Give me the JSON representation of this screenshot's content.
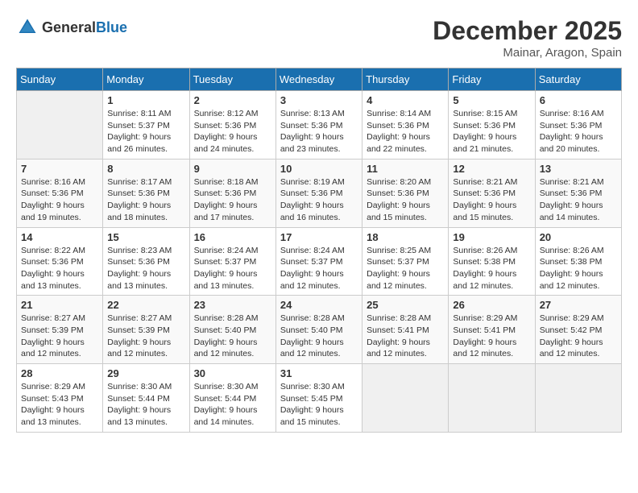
{
  "header": {
    "logo_general": "General",
    "logo_blue": "Blue",
    "title": "December 2025",
    "location": "Mainar, Aragon, Spain"
  },
  "weekdays": [
    "Sunday",
    "Monday",
    "Tuesday",
    "Wednesday",
    "Thursday",
    "Friday",
    "Saturday"
  ],
  "weeks": [
    [
      {
        "day": "",
        "info": ""
      },
      {
        "day": "1",
        "info": "Sunrise: 8:11 AM\nSunset: 5:37 PM\nDaylight: 9 hours and 26 minutes."
      },
      {
        "day": "2",
        "info": "Sunrise: 8:12 AM\nSunset: 5:36 PM\nDaylight: 9 hours and 24 minutes."
      },
      {
        "day": "3",
        "info": "Sunrise: 8:13 AM\nSunset: 5:36 PM\nDaylight: 9 hours and 23 minutes."
      },
      {
        "day": "4",
        "info": "Sunrise: 8:14 AM\nSunset: 5:36 PM\nDaylight: 9 hours and 22 minutes."
      },
      {
        "day": "5",
        "info": "Sunrise: 8:15 AM\nSunset: 5:36 PM\nDaylight: 9 hours and 21 minutes."
      },
      {
        "day": "6",
        "info": "Sunrise: 8:16 AM\nSunset: 5:36 PM\nDaylight: 9 hours and 20 minutes."
      }
    ],
    [
      {
        "day": "7",
        "info": "Sunrise: 8:16 AM\nSunset: 5:36 PM\nDaylight: 9 hours and 19 minutes."
      },
      {
        "day": "8",
        "info": "Sunrise: 8:17 AM\nSunset: 5:36 PM\nDaylight: 9 hours and 18 minutes."
      },
      {
        "day": "9",
        "info": "Sunrise: 8:18 AM\nSunset: 5:36 PM\nDaylight: 9 hours and 17 minutes."
      },
      {
        "day": "10",
        "info": "Sunrise: 8:19 AM\nSunset: 5:36 PM\nDaylight: 9 hours and 16 minutes."
      },
      {
        "day": "11",
        "info": "Sunrise: 8:20 AM\nSunset: 5:36 PM\nDaylight: 9 hours and 15 minutes."
      },
      {
        "day": "12",
        "info": "Sunrise: 8:21 AM\nSunset: 5:36 PM\nDaylight: 9 hours and 15 minutes."
      },
      {
        "day": "13",
        "info": "Sunrise: 8:21 AM\nSunset: 5:36 PM\nDaylight: 9 hours and 14 minutes."
      }
    ],
    [
      {
        "day": "14",
        "info": "Sunrise: 8:22 AM\nSunset: 5:36 PM\nDaylight: 9 hours and 13 minutes."
      },
      {
        "day": "15",
        "info": "Sunrise: 8:23 AM\nSunset: 5:36 PM\nDaylight: 9 hours and 13 minutes."
      },
      {
        "day": "16",
        "info": "Sunrise: 8:24 AM\nSunset: 5:37 PM\nDaylight: 9 hours and 13 minutes."
      },
      {
        "day": "17",
        "info": "Sunrise: 8:24 AM\nSunset: 5:37 PM\nDaylight: 9 hours and 12 minutes."
      },
      {
        "day": "18",
        "info": "Sunrise: 8:25 AM\nSunset: 5:37 PM\nDaylight: 9 hours and 12 minutes."
      },
      {
        "day": "19",
        "info": "Sunrise: 8:26 AM\nSunset: 5:38 PM\nDaylight: 9 hours and 12 minutes."
      },
      {
        "day": "20",
        "info": "Sunrise: 8:26 AM\nSunset: 5:38 PM\nDaylight: 9 hours and 12 minutes."
      }
    ],
    [
      {
        "day": "21",
        "info": "Sunrise: 8:27 AM\nSunset: 5:39 PM\nDaylight: 9 hours and 12 minutes."
      },
      {
        "day": "22",
        "info": "Sunrise: 8:27 AM\nSunset: 5:39 PM\nDaylight: 9 hours and 12 minutes."
      },
      {
        "day": "23",
        "info": "Sunrise: 8:28 AM\nSunset: 5:40 PM\nDaylight: 9 hours and 12 minutes."
      },
      {
        "day": "24",
        "info": "Sunrise: 8:28 AM\nSunset: 5:40 PM\nDaylight: 9 hours and 12 minutes."
      },
      {
        "day": "25",
        "info": "Sunrise: 8:28 AM\nSunset: 5:41 PM\nDaylight: 9 hours and 12 minutes."
      },
      {
        "day": "26",
        "info": "Sunrise: 8:29 AM\nSunset: 5:41 PM\nDaylight: 9 hours and 12 minutes."
      },
      {
        "day": "27",
        "info": "Sunrise: 8:29 AM\nSunset: 5:42 PM\nDaylight: 9 hours and 12 minutes."
      }
    ],
    [
      {
        "day": "28",
        "info": "Sunrise: 8:29 AM\nSunset: 5:43 PM\nDaylight: 9 hours and 13 minutes."
      },
      {
        "day": "29",
        "info": "Sunrise: 8:30 AM\nSunset: 5:44 PM\nDaylight: 9 hours and 13 minutes."
      },
      {
        "day": "30",
        "info": "Sunrise: 8:30 AM\nSunset: 5:44 PM\nDaylight: 9 hours and 14 minutes."
      },
      {
        "day": "31",
        "info": "Sunrise: 8:30 AM\nSunset: 5:45 PM\nDaylight: 9 hours and 15 minutes."
      },
      {
        "day": "",
        "info": ""
      },
      {
        "day": "",
        "info": ""
      },
      {
        "day": "",
        "info": ""
      }
    ]
  ]
}
